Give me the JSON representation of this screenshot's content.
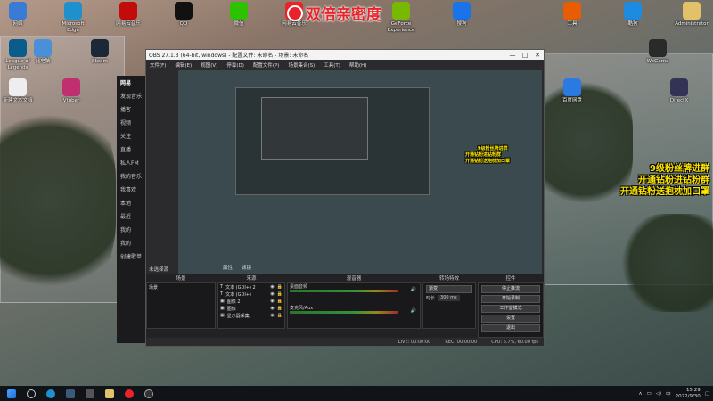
{
  "overlay": {
    "banner": "双倍亲密度",
    "lines": [
      "9级粉丝牌进群",
      "开通钻粉进钻粉群",
      "开通钻粉送抱枕加口罩"
    ],
    "lines_small": [
      "9级粉丝牌进群",
      "开通钻粉进钻粉群",
      "开通钻粉送抱枕加口罩"
    ]
  },
  "desktop_icons": [
    {
      "label": "网络",
      "icon": "network-icon",
      "color": "#3a7bd5"
    },
    {
      "label": "Microsoft Edge",
      "icon": "edge-icon",
      "color": "#1f8fce"
    },
    {
      "label": "网易云音乐",
      "icon": "music-icon",
      "color": "#c20c0c"
    },
    {
      "label": "QQ",
      "icon": "qq-icon",
      "color": "#111111"
    },
    {
      "label": "微信",
      "icon": "wechat-icon",
      "color": "#2dc100"
    },
    {
      "label": "网易云音乐",
      "icon": "netease-icon",
      "color": "#e8232a"
    },
    {
      "label": "GeForce Experience",
      "icon": "geforce-icon",
      "color": "#76b900"
    },
    {
      "label": "搜狗",
      "icon": "sogou-icon",
      "color": "#1a73e8"
    },
    {
      "label": "工具",
      "icon": "tool-icon",
      "color": "#e85d04"
    },
    {
      "label": "酷狗",
      "icon": "kugou-icon",
      "color": "#1c8be0"
    },
    {
      "label": "Administrator",
      "icon": "folder-icon",
      "color": "#e2c16b"
    },
    {
      "label": "League of Legends",
      "icon": "lol-icon",
      "color": "#0a5c8a"
    },
    {
      "label": "此电脑",
      "icon": "computer-icon",
      "color": "#4a90d9"
    },
    {
      "label": "Steam",
      "icon": "steam-icon",
      "color": "#1b2838"
    },
    {
      "label": "新建文本文档",
      "icon": "document-icon",
      "color": "#eeeeee"
    },
    {
      "label": "Vtuber",
      "icon": "vtuber-icon",
      "color": "#c03070"
    },
    {
      "label": "WeGame",
      "icon": "wegame-icon",
      "color": "#2a2a2a"
    },
    {
      "label": "百度网盘",
      "icon": "baidu-icon",
      "color": "#2a7ae2"
    },
    {
      "label": "DirectX",
      "icon": "dx-icon",
      "color": "#333355"
    }
  ],
  "music_app": {
    "title": "网易",
    "items": [
      "发现音乐",
      "播客",
      "视频",
      "关注",
      "直播",
      "私人FM",
      "我的音乐",
      "我喜欢",
      "本地",
      "最近",
      "我的",
      "我的",
      "创建歌单"
    ]
  },
  "obs": {
    "title": "OBS 27.1.3 (64-bit, windows) - 配置文件: 未命名 - 场景: 未命名",
    "menu": [
      "文件(F)",
      "编辑(E)",
      "视图(V)",
      "停靠(D)",
      "配置文件(P)",
      "场景集合(S)",
      "工具(T)",
      "帮助(H)"
    ],
    "no_source": "未选择源",
    "tabs": [
      "属性",
      "滤镜"
    ],
    "panels": {
      "scenes": {
        "title": "场景",
        "items": [
          "场景"
        ]
      },
      "sources": {
        "title": "来源",
        "items": [
          "文本 (GDI+) 2",
          "文本 (GDI+)",
          "图像 2",
          "图像",
          "显示器采集"
        ]
      },
      "mixer": {
        "title": "混音器",
        "channels": [
          "桌面音频",
          "麦克风/Aux"
        ]
      },
      "transitions": {
        "title": "转场特效",
        "type": "渐变",
        "duration_label": "时长",
        "duration": "300 ms"
      },
      "controls": {
        "title": "控件",
        "buttons": [
          "停止推流",
          "开始录制",
          "工作室模式",
          "设置",
          "退出"
        ]
      }
    },
    "status": [
      "LIVE: 00:00:00",
      "REC: 00:00:00",
      "CPU: 6.7%, 60.00 fps"
    ]
  },
  "taskbar": {
    "time": "15:29",
    "date": "2022/9/30",
    "lang": "中"
  }
}
